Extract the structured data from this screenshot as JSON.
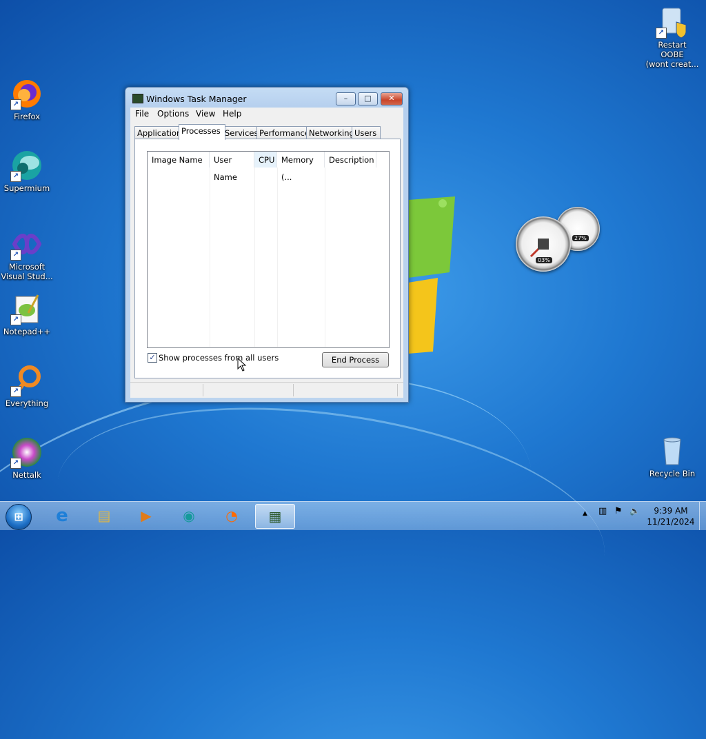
{
  "desktop": {
    "icons": [
      {
        "label": "Firefox",
        "icon": "firefox-icon",
        "color": "#ff7b00"
      },
      {
        "label": "Supermium",
        "icon": "supermium-icon",
        "color": "#1aa3a3"
      },
      {
        "label": "Microsoft Visual Stud...",
        "icon": "visual-studio-icon",
        "color": "#6a3fc9"
      },
      {
        "label": "Notepad++",
        "icon": "notepadpp-icon",
        "color": "#7cc240"
      },
      {
        "label": "Everything",
        "icon": "everything-icon",
        "color": "#f08a24"
      },
      {
        "label": "Nettalk",
        "icon": "nettalk-icon",
        "color": "#c94ac9"
      }
    ],
    "top_right_icon": {
      "label_line1": "Restart OOBE",
      "label_line2": "(wont creat..."
    },
    "recycle_bin": {
      "label": "Recycle Bin"
    },
    "gadget": {
      "cpu": "03%",
      "memory": "27%"
    }
  },
  "window": {
    "title": "Windows Task Manager",
    "controls": {
      "minimize": "–",
      "maximize": "□",
      "close": "✕"
    },
    "menu": [
      "File",
      "Options",
      "View",
      "Help"
    ],
    "tabs": [
      "Applications",
      "Processes",
      "Services",
      "Performance",
      "Networking",
      "Users"
    ],
    "active_tab": "Processes",
    "columns": [
      "Image Name",
      "User Name",
      "CPU",
      "Memory (...",
      "Description"
    ],
    "sorted_column": "CPU",
    "show_all_users_label": "Show processes from all users",
    "show_all_users_checked": true,
    "check_mark": "✓",
    "end_process_label": "End Process"
  },
  "taskbar": {
    "start": "⊞",
    "pinned": [
      {
        "name": "internet-explorer-icon",
        "glyph": "e"
      },
      {
        "name": "explorer-folder-icon",
        "glyph": "▤"
      },
      {
        "name": "media-player-icon",
        "glyph": "▶"
      },
      {
        "name": "supermium-icon",
        "glyph": "◉"
      },
      {
        "name": "firefox-icon",
        "glyph": "◔"
      },
      {
        "name": "task-manager-icon",
        "glyph": "▦"
      }
    ],
    "tray": {
      "chevron": "▲",
      "network": "▥",
      "flag": "⚑",
      "volume": "🔈"
    },
    "time": "9:39 AM",
    "date": "11/21/2024"
  }
}
